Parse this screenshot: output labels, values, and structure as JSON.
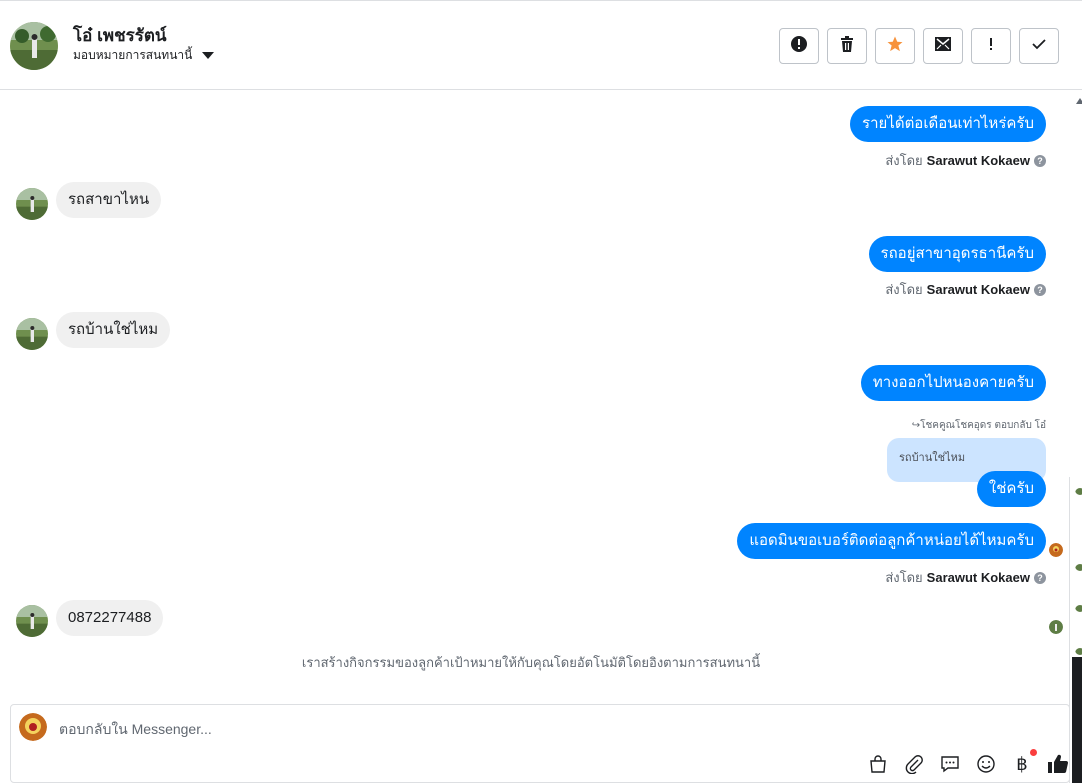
{
  "header": {
    "contact_name": "โอ๋ เพชรรัตน์",
    "assign_label": "มอบหมายการสนทนานี้",
    "actions": [
      "important-icon",
      "trash-icon",
      "star-icon",
      "mark-unread-icon",
      "spam-icon",
      "done-icon"
    ]
  },
  "messages": [
    {
      "type": "outgoing",
      "text": "รายได้ต่อเดือนเท่าไหร่ครับ",
      "sent_by_prefix": "ส่งโดย",
      "sent_by_name": "Sarawut Kokaew"
    },
    {
      "type": "incoming",
      "text": "รถสาขาไหน"
    },
    {
      "type": "outgoing",
      "text": "รถอยู่สาขาอุดรธานีครับ",
      "sent_by_prefix": "ส่งโดย",
      "sent_by_name": "Sarawut Kokaew"
    },
    {
      "type": "incoming",
      "text": "รถบ้านใช่ไหม"
    },
    {
      "type": "outgoing",
      "text": "ทางออกไปหนองคายครับ"
    },
    {
      "type": "reply",
      "reply_meta": "โชคคูณโชคอุดร ตอบกลับ โอ๋",
      "quoted_text": "รถบ้านใช่ไหม",
      "text": "ใช่ครับ"
    },
    {
      "type": "outgoing",
      "text": "แอดมินขอเบอร์ติดต่อลูกค้าหน่อยได้ไหมครับ",
      "sent_by_prefix": "ส่งโดย",
      "sent_by_name": "Sarawut Kokaew"
    },
    {
      "type": "incoming",
      "text": "0872277488"
    }
  ],
  "system_note": "เราสร้างกิจกรรมของลูกค้าเป้าหมายให้กับคุณโดยอัตโนมัติโดยอิงตามการสนทนานี้",
  "composer": {
    "placeholder": "ตอบกลับใน Messenger...",
    "tools": [
      "shopping-bag-icon",
      "attachment-icon",
      "saved-reply-icon",
      "emoji-icon",
      "payment-icon",
      "thumbs-up-icon"
    ]
  },
  "colors": {
    "outgoing_bubble": "#0084ff",
    "incoming_bubble": "#f0f0f0",
    "quoted_bubble": "#cce4ff",
    "star_active": "#f7923b"
  }
}
